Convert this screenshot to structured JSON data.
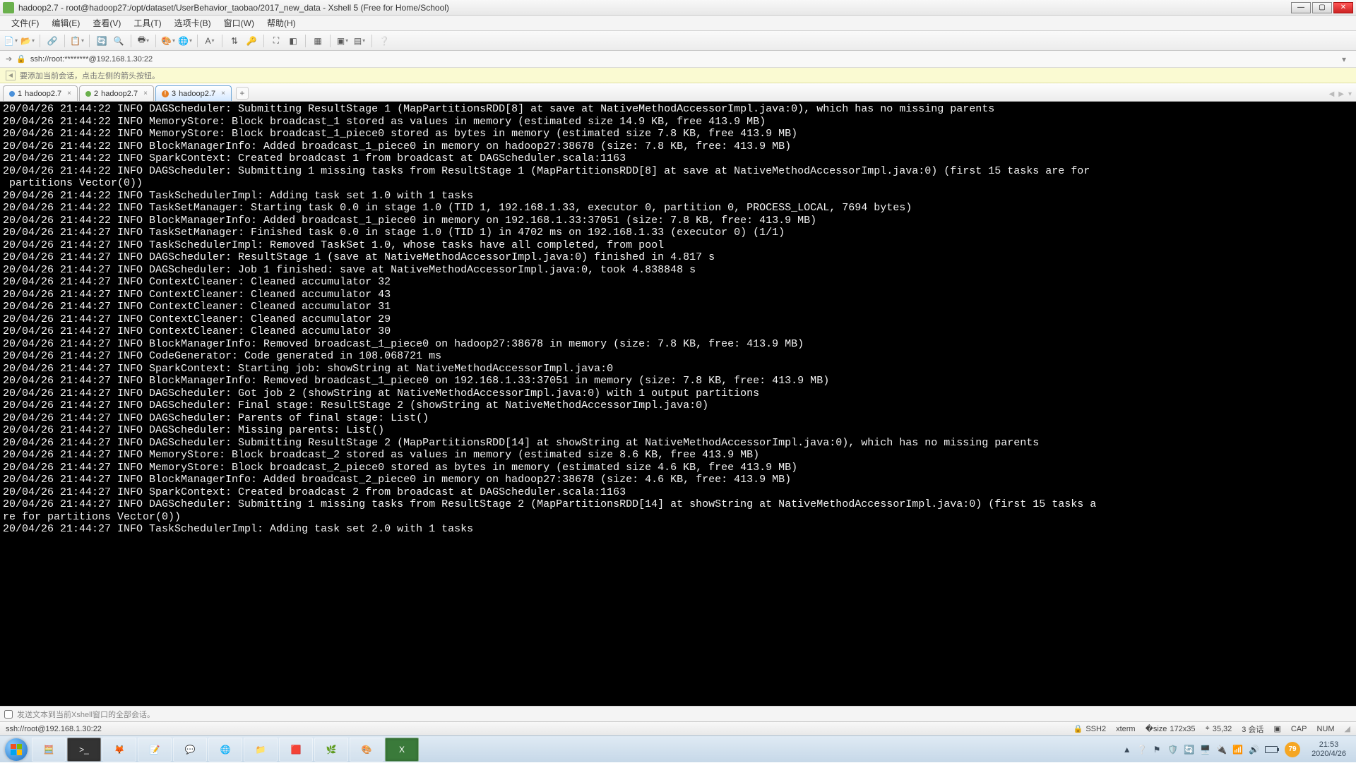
{
  "window": {
    "title": "hadoop2.7 - root@hadoop27:/opt/dataset/UserBehavior_taobao/2017_new_data - Xshell 5 (Free for Home/School)"
  },
  "menu": {
    "file": "文件(F)",
    "edit": "编辑(E)",
    "view": "查看(V)",
    "tools": "工具(T)",
    "option": "选项卡(B)",
    "window": "窗口(W)",
    "help": "帮助(H)"
  },
  "address": {
    "prefix": "➔",
    "text": "ssh://root:********@192.168.1.30:22"
  },
  "hint": {
    "text": "要添加当前会话，点击左侧的箭头按钮。"
  },
  "tabs": [
    {
      "idx": "1",
      "label": "hadoop2.7",
      "status": "blue"
    },
    {
      "idx": "2",
      "label": "hadoop2.7",
      "status": "green"
    },
    {
      "idx": "3",
      "label": "hadoop2.7",
      "status": "warn"
    }
  ],
  "terminal_lines": [
    "20/04/26 21:44:22 INFO DAGScheduler: Submitting ResultStage 1 (MapPartitionsRDD[8] at save at NativeMethodAccessorImpl.java:0), which has no missing parents",
    "20/04/26 21:44:22 INFO MemoryStore: Block broadcast_1 stored as values in memory (estimated size 14.9 KB, free 413.9 MB)",
    "20/04/26 21:44:22 INFO MemoryStore: Block broadcast_1_piece0 stored as bytes in memory (estimated size 7.8 KB, free 413.9 MB)",
    "20/04/26 21:44:22 INFO BlockManagerInfo: Added broadcast_1_piece0 in memory on hadoop27:38678 (size: 7.8 KB, free: 413.9 MB)",
    "20/04/26 21:44:22 INFO SparkContext: Created broadcast 1 from broadcast at DAGScheduler.scala:1163",
    "20/04/26 21:44:22 INFO DAGScheduler: Submitting 1 missing tasks from ResultStage 1 (MapPartitionsRDD[8] at save at NativeMethodAccessorImpl.java:0) (first 15 tasks are for",
    " partitions Vector(0))",
    "20/04/26 21:44:22 INFO TaskSchedulerImpl: Adding task set 1.0 with 1 tasks",
    "20/04/26 21:44:22 INFO TaskSetManager: Starting task 0.0 in stage 1.0 (TID 1, 192.168.1.33, executor 0, partition 0, PROCESS_LOCAL, 7694 bytes)",
    "20/04/26 21:44:22 INFO BlockManagerInfo: Added broadcast_1_piece0 in memory on 192.168.1.33:37051 (size: 7.8 KB, free: 413.9 MB)",
    "20/04/26 21:44:27 INFO TaskSetManager: Finished task 0.0 in stage 1.0 (TID 1) in 4702 ms on 192.168.1.33 (executor 0) (1/1)",
    "20/04/26 21:44:27 INFO TaskSchedulerImpl: Removed TaskSet 1.0, whose tasks have all completed, from pool",
    "20/04/26 21:44:27 INFO DAGScheduler: ResultStage 1 (save at NativeMethodAccessorImpl.java:0) finished in 4.817 s",
    "20/04/26 21:44:27 INFO DAGScheduler: Job 1 finished: save at NativeMethodAccessorImpl.java:0, took 4.838848 s",
    "20/04/26 21:44:27 INFO ContextCleaner: Cleaned accumulator 32",
    "20/04/26 21:44:27 INFO ContextCleaner: Cleaned accumulator 43",
    "20/04/26 21:44:27 INFO ContextCleaner: Cleaned accumulator 31",
    "20/04/26 21:44:27 INFO ContextCleaner: Cleaned accumulator 29",
    "20/04/26 21:44:27 INFO ContextCleaner: Cleaned accumulator 30",
    "20/04/26 21:44:27 INFO BlockManagerInfo: Removed broadcast_1_piece0 on hadoop27:38678 in memory (size: 7.8 KB, free: 413.9 MB)",
    "20/04/26 21:44:27 INFO CodeGenerator: Code generated in 108.068721 ms",
    "20/04/26 21:44:27 INFO SparkContext: Starting job: showString at NativeMethodAccessorImpl.java:0",
    "20/04/26 21:44:27 INFO BlockManagerInfo: Removed broadcast_1_piece0 on 192.168.1.33:37051 in memory (size: 7.8 KB, free: 413.9 MB)",
    "20/04/26 21:44:27 INFO DAGScheduler: Got job 2 (showString at NativeMethodAccessorImpl.java:0) with 1 output partitions",
    "20/04/26 21:44:27 INFO DAGScheduler: Final stage: ResultStage 2 (showString at NativeMethodAccessorImpl.java:0)",
    "20/04/26 21:44:27 INFO DAGScheduler: Parents of final stage: List()",
    "20/04/26 21:44:27 INFO DAGScheduler: Missing parents: List()",
    "20/04/26 21:44:27 INFO DAGScheduler: Submitting ResultStage 2 (MapPartitionsRDD[14] at showString at NativeMethodAccessorImpl.java:0), which has no missing parents",
    "20/04/26 21:44:27 INFO MemoryStore: Block broadcast_2 stored as values in memory (estimated size 8.6 KB, free 413.9 MB)",
    "20/04/26 21:44:27 INFO MemoryStore: Block broadcast_2_piece0 stored as bytes in memory (estimated size 4.6 KB, free 413.9 MB)",
    "20/04/26 21:44:27 INFO BlockManagerInfo: Added broadcast_2_piece0 in memory on hadoop27:38678 (size: 4.6 KB, free: 413.9 MB)",
    "20/04/26 21:44:27 INFO SparkContext: Created broadcast 2 from broadcast at DAGScheduler.scala:1163",
    "20/04/26 21:44:27 INFO DAGScheduler: Submitting 1 missing tasks from ResultStage 2 (MapPartitionsRDD[14] at showString at NativeMethodAccessorImpl.java:0) (first 15 tasks a",
    "re for partitions Vector(0))",
    "20/04/26 21:44:27 INFO TaskSchedulerImpl: Adding task set 2.0 with 1 tasks"
  ],
  "sendbar": {
    "text": "发送文本到当前Xshell窗口的全部会话。"
  },
  "status": {
    "left": "ssh://root@192.168.1.30:22",
    "ssh": "SSH2",
    "term": "xterm",
    "size": "172x35",
    "cursor": "35,32",
    "sessions": "3 会话",
    "cap": "CAP",
    "num": "NUM"
  },
  "tray": {
    "badge": "79",
    "time": "21:53",
    "date": "2020/4/26"
  }
}
